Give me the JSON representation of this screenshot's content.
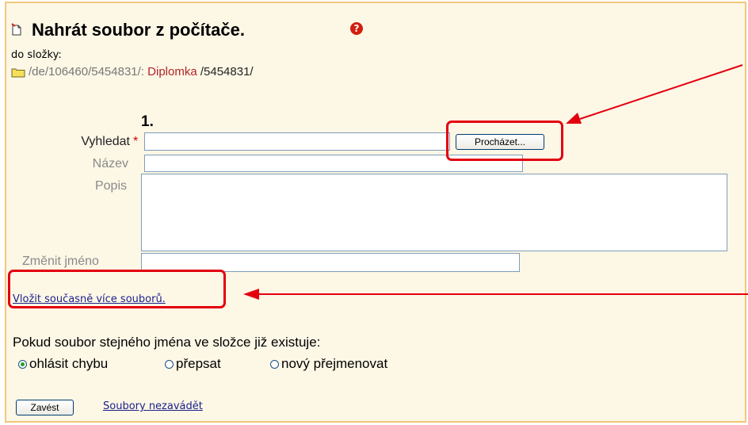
{
  "header": {
    "title": "Nahrát soubor z počítače.",
    "help_icon_glyph": "?",
    "folder_label": "do složky:",
    "path_prefix": "/de/106460/5454831/:",
    "path_link": "Diplomka",
    "path_suffix": "/5454831/"
  },
  "form": {
    "step_number": "1.",
    "search_label": "Vyhledat",
    "required_mark": "*",
    "search_value": "",
    "browse_button": "Procházet...",
    "name_label": "Název",
    "name_value": "",
    "description_label": "Popis",
    "description_value": "",
    "rename_label": "Změnit jméno",
    "rename_value": "",
    "multi_upload_link": "Vložit současně více souborů."
  },
  "conflict": {
    "label": "Pokud soubor stejného jména ve složce již existuje:",
    "options": [
      {
        "label": "ohlásit chybu",
        "checked": true
      },
      {
        "label": "přepsat",
        "checked": false
      },
      {
        "label": "nový přejmenovat",
        "checked": false
      }
    ]
  },
  "actions": {
    "submit_button": "Zavést",
    "no_upload_link": "Soubory nezavádět"
  },
  "colors": {
    "panel_background": "#fdf7e6",
    "panel_border": "#f2c879",
    "link": "#1a1f8a",
    "path_link": "#b0252a",
    "callout": "#e3000f"
  },
  "icons": {
    "page": "page-icon",
    "help": "help-icon",
    "folder": "folder-icon"
  }
}
